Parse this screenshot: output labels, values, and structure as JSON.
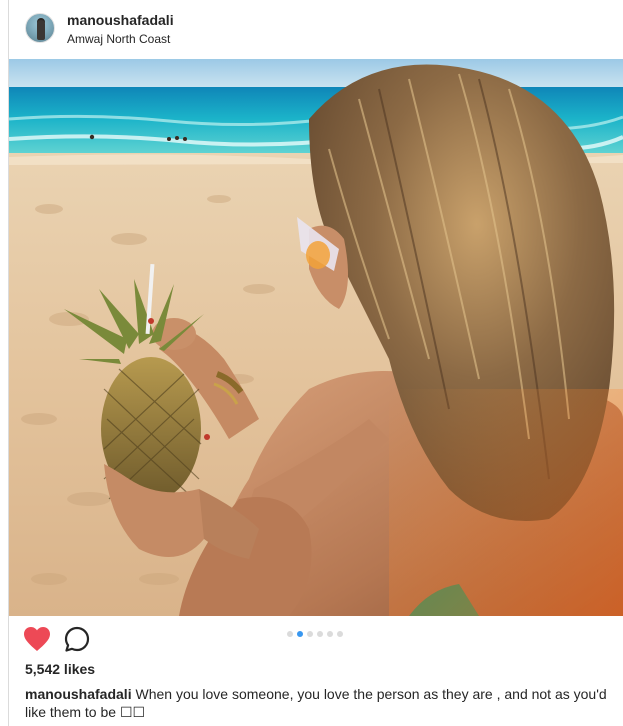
{
  "header": {
    "username": "manoushafadali",
    "location": "Amwaj North Coast"
  },
  "photo": {
    "alt": "Woman on a sandy beach holding a pineapple drink with the turquoise sea behind"
  },
  "actions": {
    "like_icon": "heart-icon",
    "comment_icon": "comment-icon",
    "liked_color": "#ed4956"
  },
  "carousel": {
    "count": 6,
    "active_index": 1,
    "active_color": "#3897f0",
    "inactive_color": "#dbdbdb"
  },
  "likes": {
    "label": "5,542 likes"
  },
  "caption": {
    "username": "manoushafadali",
    "text": "When you love someone, you love the person as they are , and not as you'd like them to be ☐☐"
  }
}
